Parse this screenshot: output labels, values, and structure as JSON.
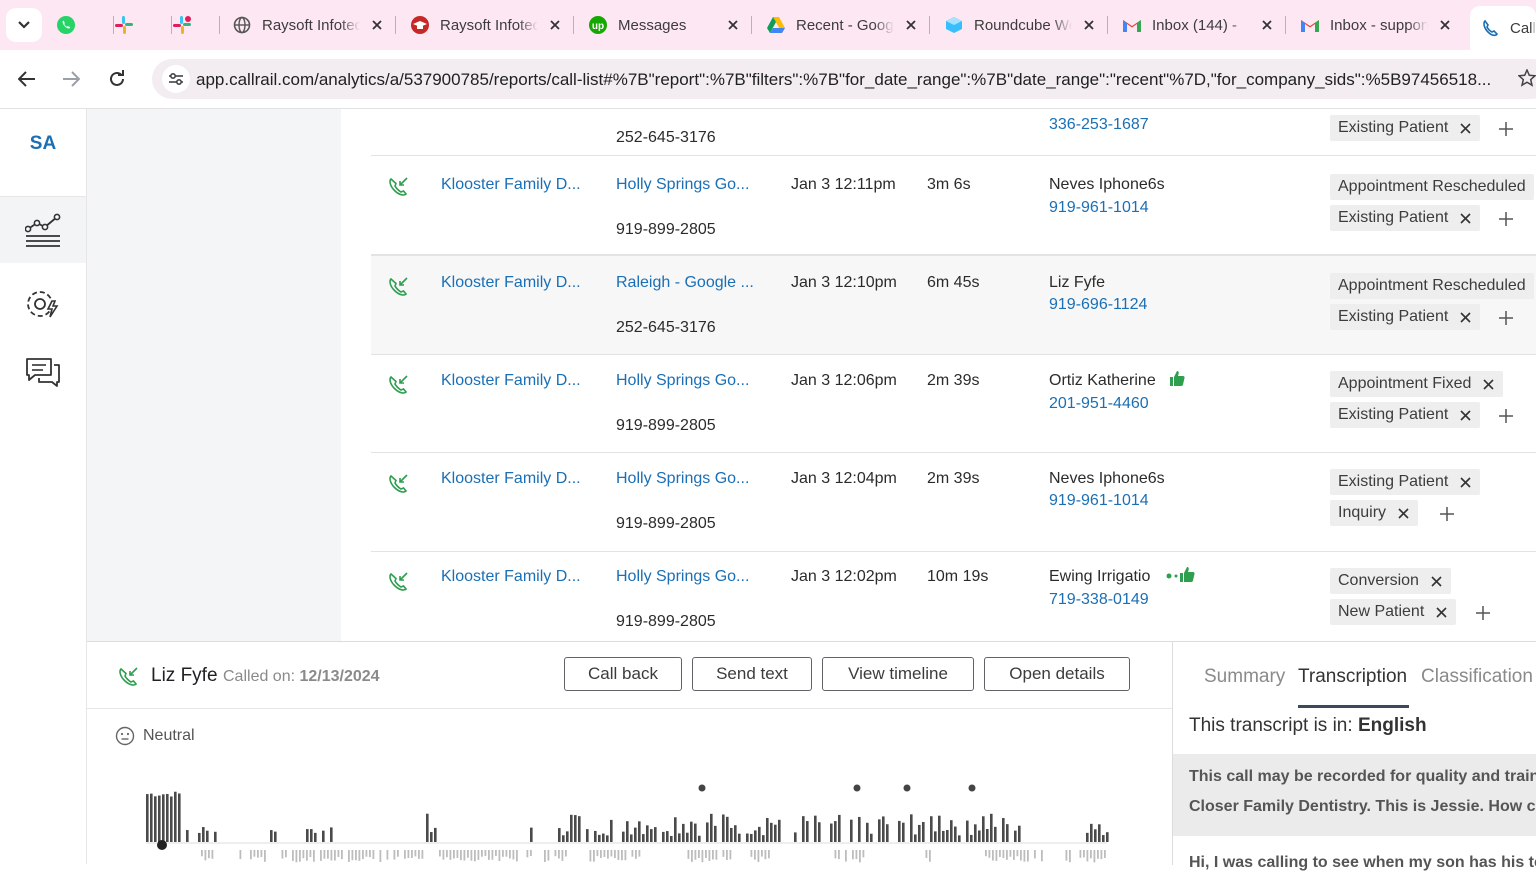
{
  "browser": {
    "tabs": [
      {
        "title": "",
        "icon": "whatsapp-icon"
      },
      {
        "title": "",
        "icon": "slack-icon"
      },
      {
        "title": "",
        "icon": "slack-icon"
      },
      {
        "title": "Raysoft Infotech",
        "icon": "globe-icon"
      },
      {
        "title": "Raysoft Infotech",
        "icon": "graduation-cap-icon"
      },
      {
        "title": "Messages",
        "icon": "upwork-icon"
      },
      {
        "title": "Recent - Google Drive",
        "icon": "google-drive-icon"
      },
      {
        "title": "Roundcube Webmail",
        "icon": "roundcube-icon"
      },
      {
        "title": "Inbox (144) -",
        "icon": "gmail-icon"
      },
      {
        "title": "Inbox - support",
        "icon": "gmail-icon"
      },
      {
        "title": "Call",
        "icon": "callrail-icon"
      }
    ],
    "url": "app.callrail.com/analytics/a/537900785/reports/call-list#%7B\"report\":%7B\"filters\":%7B\"for_date_range\":%7B\"date_range\":\"recent\"%7D,\"for_company_sids\":%5B97456518..."
  },
  "leftnav": {
    "avatar": "SA",
    "items": [
      "analytics-icon",
      "settings-automation-icon",
      "conversations-icon"
    ]
  },
  "top_partial_row": {
    "tracking_number": "252-645-3176",
    "caller_phone": "336-253-1687",
    "tags": [
      "Existing Patient"
    ]
  },
  "calls": [
    {
      "company": "Klooster Family D...",
      "source": "Holly Springs Go...",
      "tracking_number": "919-899-2805",
      "time": "Jan 3 12:11pm",
      "duration": "3m 6s",
      "caller_name": "Neves Iphone6s",
      "caller_phone": "919-961-1014",
      "tags": [
        "Appointment Rescheduled",
        "Existing Patient"
      ]
    },
    {
      "company": "Klooster Family D...",
      "source": "Raleigh - Google ...",
      "tracking_number": "252-645-3176",
      "time": "Jan 3 12:10pm",
      "duration": "6m 45s",
      "caller_name": "Liz Fyfe",
      "caller_phone": "919-696-1124",
      "tags": [
        "Appointment Rescheduled",
        "Existing Patient"
      ]
    },
    {
      "company": "Klooster Family D...",
      "source": "Holly Springs Go...",
      "tracking_number": "919-899-2805",
      "time": "Jan 3 12:06pm",
      "duration": "2m 39s",
      "caller_name": "Ortiz Katherine",
      "caller_phone": "201-951-4460",
      "tags": [
        "Appointment Fixed",
        "Existing Patient"
      ]
    },
    {
      "company": "Klooster Family D...",
      "source": "Holly Springs Go...",
      "tracking_number": "919-899-2805",
      "time": "Jan 3 12:04pm",
      "duration": "2m 39s",
      "caller_name": "Neves Iphone6s",
      "caller_phone": "919-961-1014",
      "tags": [
        "Existing Patient",
        "Inquiry"
      ]
    },
    {
      "company": "Klooster Family D...",
      "source": "Holly Springs Go...",
      "tracking_number": "919-899-2805",
      "time": "Jan 3 12:02pm",
      "duration": "10m 19s",
      "caller_name": "Ewing Irrigatio",
      "caller_phone": "719-338-0149",
      "tags": [
        "Conversion",
        "New Patient"
      ]
    }
  ],
  "panel": {
    "caller_name": "Liz Fyfe",
    "called_on_label": "Called on:",
    "called_on_date": "12/13/2024",
    "buttons": {
      "call_back": "Call back",
      "send_text": "Send text",
      "view_timeline": "View timeline",
      "open_details": "Open details"
    },
    "sentiment": "Neutral",
    "tabs": [
      "Summary",
      "Transcription",
      "Classification"
    ],
    "active_tab": "Transcription",
    "transcript_lang_label": "This transcript is in:",
    "transcript_lang": "English",
    "agent_line_1": "This call may be recorded for quality and training",
    "agent_line_2": "Closer Family Dentistry. This is Jessie. How can",
    "caller_line": "Hi, I was calling to see when my son has his teeth"
  },
  "colors": {
    "link": "#1a6fb5",
    "accent_green": "#2e9e4f",
    "tabstrip": "#fde7f2"
  }
}
